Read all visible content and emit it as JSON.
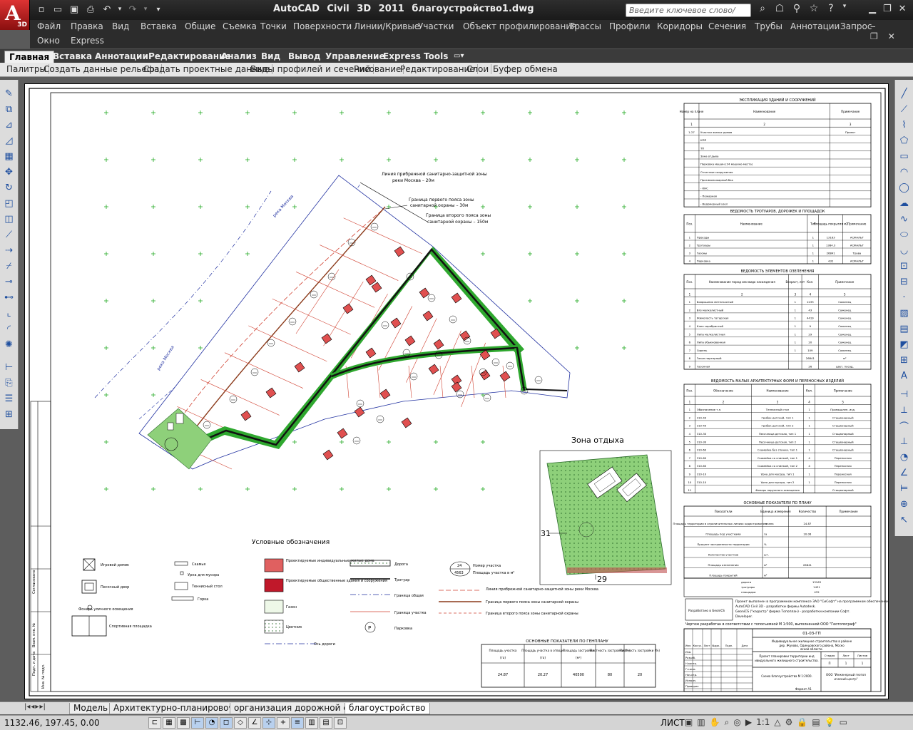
{
  "app": {
    "logo_letter": "A",
    "logo_version": "3D",
    "title": "AutoCAD Civil 3D 2011   благоустройство1.dwg",
    "search_placeholder": "Введите ключевое слово/фразу"
  },
  "menubar": {
    "row1": [
      "Файл",
      "Правка",
      "Вид",
      "Вставка",
      "Общие",
      "Съемка",
      "Точки",
      "Поверхности",
      "Линии/Кривые",
      "Участки",
      "Объект профилирования",
      "Трассы",
      "Профили",
      "Коридоры",
      "Сечения",
      "Трубы",
      "Аннотации",
      "Запрос"
    ],
    "row2": [
      "Окно",
      "Express"
    ]
  },
  "ribbon": {
    "tabs": [
      "Главная",
      "Вставка",
      "Аннотации",
      "Редактирование",
      "Анализ",
      "Вид",
      "Вывод",
      "Управление",
      "Express Tools"
    ],
    "active_tab": "Главная",
    "panels": [
      "Палитры",
      "Создать данные рельефа",
      "Создать проектные данные",
      "Виды профилей и сечений",
      "Рисование",
      "Редактирование",
      "Слои",
      "Буфер обмена"
    ]
  },
  "drawing": {
    "zone_title": "Зона отдыха",
    "legend_title": "Условные обозначения",
    "labels": {
      "sanitary_line": "Линия прибрежной санитарно-защитной зоны",
      "sanitary_line2": "реки Москва – 20м",
      "zone1": "Граница первого пояса зоны",
      "zone1b": "санитарной охраны – 30м",
      "zone2": "Граница второго пояса зоны",
      "zone2b": "санитарной охраны – 150м",
      "river1": "река Москва",
      "river2": "река Москва",
      "zone_num_left": "31",
      "zone_num_bottom": "29"
    },
    "legend_items": [
      "Игровой домик",
      "Песочный двор",
      "Фонарь уличного освещения",
      "Спортивная площадка",
      "Скамья",
      "Урна для мусора",
      "Теннисный стол",
      "Горка",
      "Проектируемые индивидуальные жилые дома",
      "Проектируемые общественные здания и сооружения",
      "Газон",
      "Цветник",
      "Ось дороги",
      "Дорога",
      "Тротуар",
      "Граница общая",
      "Граница участка",
      "Парковка",
      "Номер участка",
      "Площадь участка в м²",
      "Линия прибрежной санитарно-защитной зоны реки Москва",
      "Граница первого пояса зоны санитарной охраны",
      "Граница второго пояса зоны санитарной охраны"
    ],
    "legend_sample_num": "24",
    "legend_sample_area": "4563",
    "tables": {
      "buildings_title": "ЭКСПЛИКАЦИЯ ЗДАНИЙ И СООРУЖЕНИЙ",
      "buildings_head": [
        "Номер на плане",
        "Наименование",
        "Примечание"
      ],
      "buildings_nums": [
        "1",
        "2",
        "3"
      ],
      "buildings_rows": [
        [
          "1-27",
          "Участки жилых домов",
          "Проект"
        ],
        [
          "",
          "КПП",
          ""
        ],
        [
          "",
          "ТП",
          ""
        ],
        [
          "",
          "Зона отдыха",
          ""
        ],
        [
          "",
          "Парковка машин (34 машино-места)",
          ""
        ],
        [
          "",
          "Отчетные сооружения",
          ""
        ],
        [
          "",
          "Противопожарный бак",
          ""
        ],
        [
          "",
          "- КНС",
          ""
        ],
        [
          "",
          "- Пожарная",
          ""
        ],
        [
          "",
          "- Водомерный узел",
          ""
        ]
      ],
      "roads_title": "ВЕДОМОСТЬ ТРОТУАРОВ, ДОРОЖЕК И ПЛОЩАДОК",
      "roads_head": [
        "Поз.",
        "Наименование",
        "Тип",
        "Площадь покрытия м2",
        "Примечание"
      ],
      "roads_rows": [
        [
          "1",
          "Проезды",
          "1",
          "13163",
          "АСФАЛЬТ"
        ],
        [
          "2",
          "Тротуары",
          "1",
          "1384.3",
          "АСФАЛЬТ"
        ],
        [
          "3",
          "Газоны",
          "1",
          "26841",
          "Трава"
        ],
        [
          "4",
          "Парковка",
          "1",
          "432",
          "АСФАЛЬТ"
        ]
      ],
      "greening_title": "ВЕДОМОСТЬ ЭЛЕМЕНТОВ ОЗЕЛЕНЕНИЯ",
      "greening_head": [
        "Поз.",
        "Наименование пород или вида насаждения",
        "Возраст, лет",
        "Кол.",
        "Примечание"
      ],
      "greening_nums": [
        "1",
        "2",
        "3",
        "4",
        "5"
      ],
      "greening_rows": [
        [
          "1",
          "Боярышник метельчатый",
          "1",
          "1233",
          "Саженец"
        ],
        [
          "2",
          "Вяз мелколистный",
          "1",
          "43",
          "Саженец"
        ],
        [
          "3",
          "Жимолость татарская",
          "1",
          "4419",
          "Саженец"
        ],
        [
          "4",
          "Клен серебристый",
          "1",
          "9",
          "Саженец"
        ],
        [
          "5",
          "Липа мелколистная",
          "1",
          "29",
          "Саженец"
        ],
        [
          "6",
          "Липа обыкновенная",
          "1",
          "20",
          "Саженец"
        ],
        [
          "7",
          "Сирень",
          "1",
          "109",
          "Саженец"
        ],
        [
          "8",
          "Газон партерный",
          "",
          "26841",
          "м²"
        ],
        [
          "9",
          "Газонная",
          "",
          "26",
          "цвет. посад."
        ]
      ],
      "forms_title": "ВЕДОМОСТЬ МАЛЫХ АРХИТЕКТУРНЫХ ФОРМ И ПЕРЕНОСНЫХ ИЗДЕЛИЙ",
      "forms_head": [
        "Поз.",
        "Обозначение",
        "Наименование",
        "Кол.",
        "Примечание"
      ],
      "forms_nums": [
        "1",
        "2",
        "3",
        "4",
        "5"
      ],
      "forms_rows": [
        [
          "1",
          "Обозначение т.п.",
          "Теннисный стол",
          "1",
          "Промышлен. изд."
        ],
        [
          "2",
          "310-40",
          "Грибок детский, тип 1",
          "1",
          "Стационарный"
        ],
        [
          "3",
          "310-40",
          "Грибок детский, тип 2",
          "1",
          "Стационарный"
        ],
        [
          "4",
          "310-30",
          "Песочница детская, тип 1",
          "1",
          "Стационарный"
        ],
        [
          "5",
          "310-30",
          "Песочница детская, тип 2",
          "1",
          "Стационарный"
        ],
        [
          "6",
          "310-60",
          "Скамейка без спинки, тип 1",
          "1",
          "Стационарный"
        ],
        [
          "7",
          "310-60",
          "Скамейка со спинкой, тип 1",
          "4",
          "Переносная"
        ],
        [
          "8",
          "310-60",
          "Скамейка со спинкой, тип 2",
          "4",
          "Переносная"
        ],
        [
          "9",
          "310-10",
          "Урна для мусора, тип 1",
          "1",
          "Переносная"
        ],
        [
          "10",
          "310-10",
          "Урна для мусора, тип 2",
          "1",
          "Переносная"
        ],
        [
          "11",
          "",
          "Фонарь наружного освещения",
          "",
          "Стационарный"
        ]
      ],
      "indicators_title": "ОСНОВНЫЕ ПОКАЗАТЕЛИ ПО ПЛАНУ",
      "indicators_head": [
        "Показатели",
        "Единица измерения",
        "Количество",
        "Примечание"
      ],
      "indicators_rows": [
        [
          "Площадь территории в ограничительных линиях кадастрового плана",
          "га",
          "24.87",
          ""
        ],
        [
          "Площадь под участками",
          "га",
          "20.06",
          ""
        ],
        [
          "Процент застроенности территории",
          "%",
          "",
          ""
        ],
        [
          "Количество участков",
          "шт.",
          "",
          ""
        ],
        [
          "Площадь озеленения",
          "м²",
          "26841",
          ""
        ],
        [
          "Площадь покрытий",
          "м²",
          "",
          ""
        ]
      ],
      "cover_sub": [
        [
          "дороги",
          "13163"
        ],
        [
          "тротуары",
          "1431"
        ],
        [
          "площадки",
          "432"
        ]
      ],
      "main_title": "ОСНОВНЫЕ ПОКАЗАТЕЛИ ПО ГЕНПЛАНУ",
      "main_head": [
        "Площадь участка",
        "Площадь участка в отводе",
        "Площадь застройки",
        "Плотность застройки (%)",
        "Плотность застройки (%)"
      ],
      "main_units": [
        "(га)",
        "(га)",
        "(м²)"
      ],
      "main_values": [
        "24.87",
        "20.27",
        "40500",
        "80",
        "20"
      ]
    },
    "notes": [
      "Проект выполнен в программном комплексе ЗАО \"СиСофт\" на программном обеспечении",
      "AutoCAD Civil 3D - разработки фирмы Autodesk.",
      "GeoniCS (\"кадастр\" фирма Топоплан) - разработки компании Софт.",
      "Developer."
    ],
    "topo_note": "Чертеж разработан в соответствии с топосъемкой М 1:500, выполненной ООО \"Геотопограф\"",
    "stamp": {
      "code": "01-03-ГП",
      "desc": "Индивидуальное жилищное строительство в районе дер. Жуково, Одинцовского района, Московской области.",
      "project": "Проект планировки территории индивидуального жилищного строительства.",
      "sheet_title": "Схема благоустройства М 1:2000.",
      "org": "ООО \"Инженерный геотопический центр\"",
      "roles": [
        "Изм.",
        "Разраб.",
        "Н.контр.",
        "Гл.инж.",
        "Нач.отд.",
        "Исполн.",
        "Проверил"
      ],
      "cols": [
        "Изм.",
        "Кол.уч.",
        "Лист",
        "№док.",
        "Подп.",
        "Дата"
      ],
      "sheet_cols": [
        "Стадия",
        "Лист",
        "Листов"
      ],
      "sheet_vals": [
        "П",
        "1",
        "1"
      ],
      "format": "Формат А1"
    },
    "side_labels": [
      "Согласовано",
      "Взам. инв. №",
      "Подп. и дата",
      "Инв. № подл."
    ],
    "spec_box": "Разработано в GeoniCS"
  },
  "layout_tabs": [
    "Модель",
    "Архитектурно-планировочный",
    "организация дорожной сети",
    "благоустройство"
  ],
  "layout_active": "благоустройство",
  "statusbar": {
    "coords": "1132.46, 197.45, 0.00",
    "sheet": "ЛИСТ",
    "scale": "1:1"
  },
  "colors": {
    "green_road": "#2fa82f",
    "lot_fill": "#e05050",
    "red_line": "#c03020",
    "brown_line": "#8b3a1a",
    "grid_cross": "#22aa22",
    "zone_green": "#8ed07a"
  }
}
